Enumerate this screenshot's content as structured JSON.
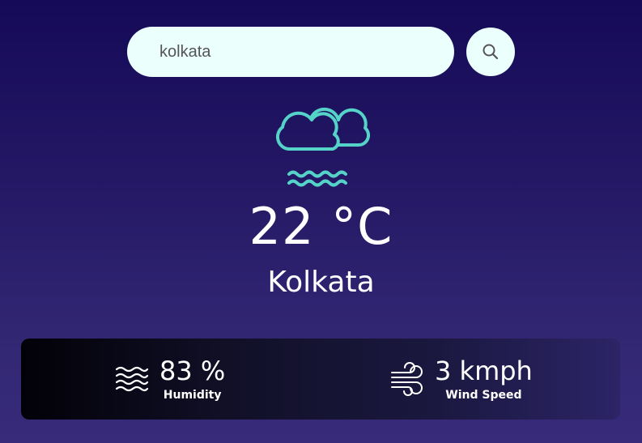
{
  "search": {
    "value": "kolkata",
    "icon": "search-icon"
  },
  "weather": {
    "icon": "mist-icon",
    "icon_color": "#55d3c8",
    "temperature": "22 °C",
    "city": "Kolkata"
  },
  "details": {
    "humidity": {
      "value": "83 %",
      "label": "Humidity",
      "icon": "humidity-icon"
    },
    "wind": {
      "value": "3 kmph",
      "label": "Wind Speed",
      "icon": "wind-icon"
    }
  },
  "colors": {
    "background_top": "#150a57",
    "background_bottom": "#372b7a",
    "input_bg": "#ebfffc",
    "accent": "#55d3c8"
  }
}
